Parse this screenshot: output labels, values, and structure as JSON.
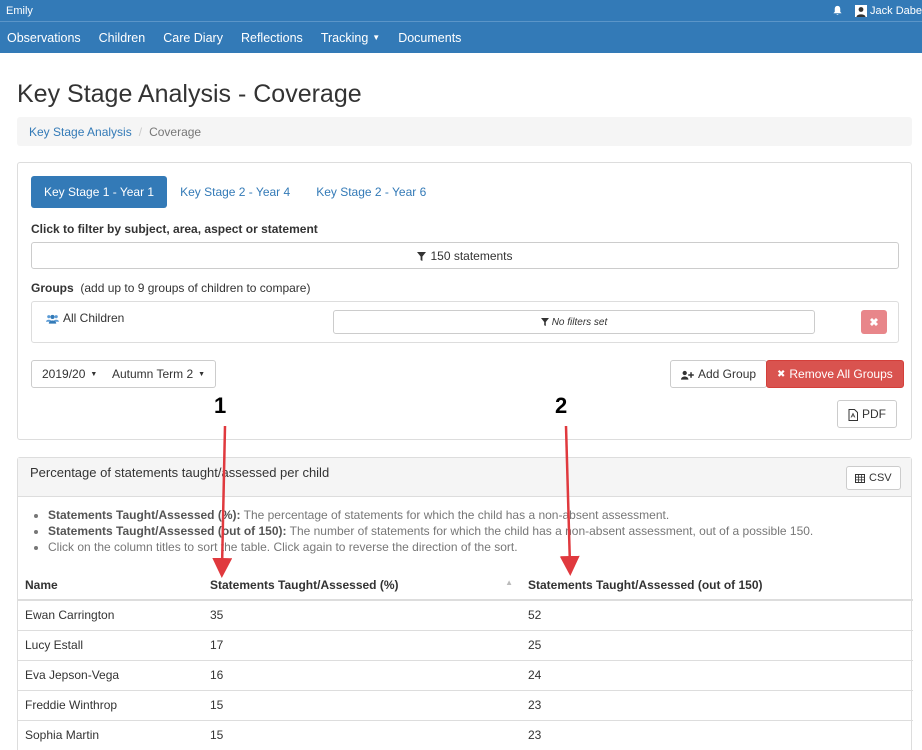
{
  "topbar": {
    "app_name": "Emily",
    "user_name": "Jack Dabe"
  },
  "nav": [
    {
      "label": "Observations"
    },
    {
      "label": "Children"
    },
    {
      "label": "Care Diary"
    },
    {
      "label": "Reflections"
    },
    {
      "label": "Tracking"
    },
    {
      "label": "Documents"
    }
  ],
  "page_title": "Key Stage Analysis - Coverage",
  "breadcrumb": {
    "link": "Key Stage Analysis",
    "active": "Coverage"
  },
  "tabs": [
    "Key Stage 1 - Year 1",
    "Key Stage 2 - Year 4",
    "Key Stage 2 - Year 6"
  ],
  "filter": {
    "label": "Click to filter by subject, area, aspect or statement",
    "button": "150 statements"
  },
  "groups": {
    "label": "Groups",
    "hint": "(add up to 9 groups of children to compare)",
    "group_name": "All Children",
    "no_filters": "No filters set"
  },
  "controls": {
    "year": "2019/20",
    "term": "Autumn Term 2",
    "add_group": "Add Group",
    "remove_all": "Remove All Groups",
    "pdf": "PDF"
  },
  "results": {
    "title": "Percentage of statements taught/assessed per child",
    "csv": "CSV",
    "notes": [
      {
        "bold": "Statements Taught/Assessed (%):",
        "text": " The percentage of statements for which the child has a non-absent assessment."
      },
      {
        "bold": "Statements Taught/Assessed (out of 150):",
        "text": " The number of statements for which the child has a non-absent assessment, out of a possible 150."
      },
      {
        "bold": "",
        "text": "Click on the column titles to sort the table. Click again to reverse the direction of the sort."
      }
    ],
    "columns": [
      "Name",
      "Statements Taught/Assessed (%)",
      "Statements Taught/Assessed (out of 150)"
    ],
    "rows": [
      [
        "Ewan Carrington",
        "35",
        "52"
      ],
      [
        "Lucy Estall",
        "17",
        "25"
      ],
      [
        "Eva Jepson-Vega",
        "16",
        "24"
      ],
      [
        "Freddie Winthrop",
        "15",
        "23"
      ],
      [
        "Sophia Martin",
        "15",
        "23"
      ]
    ]
  },
  "annotations": [
    "1",
    "2"
  ],
  "colors": {
    "primary": "#337ab7",
    "danger": "#d9534f",
    "arrow": "#e0393e"
  }
}
